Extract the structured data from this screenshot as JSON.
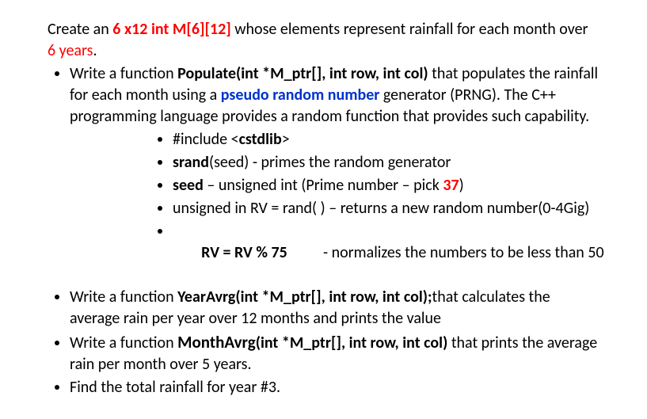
{
  "intro": {
    "p1": "Create an ",
    "p2_bold_red": "6 x12  int  M[6][12]",
    "p3": " whose elements represent rainfall for each month over ",
    "p4_red": "6 years",
    "p5": "."
  },
  "b1": {
    "t1": "Write a function ",
    "t2_bold": "Populate(int *M_ptr[], int row, int col)",
    "t3": " that populates the rainfall for each month using a ",
    "t4_bold_blue": "pseudo random number",
    "t5": " generator (PRNG).  The C++ programming language provides a random function that provides such capability."
  },
  "inner": {
    "i1_a": "#include <",
    "i1_b_bold": "cstdlib",
    "i1_c": ">",
    "i2_a_bold": "srand",
    "i2_b": "(seed)  - primes the random generator",
    "i3_a_bold": "seed",
    "i3_b": " – unsigned int (Prime number – pick ",
    "i3_c_bold_red": "37",
    "i3_d": ")",
    "i4": "unsigned in RV = rand( ) – returns a new random number(0-4Gig)",
    "i5_a_bold": "RV = RV % 75",
    "i5_b": "          - normalizes the numbers to be less than 50"
  },
  "b2": {
    "t1": "Write a function ",
    "t2_bold": "YearAvrg(int *M_ptr[], int row, int col);",
    "t3": "that calculates the average rain  per year over 12 months and prints the value"
  },
  "b3": {
    "t1": "Write a function ",
    "t2_bold": "MonthAvrg",
    "t3_bold": "(int *M_ptr[], int row, int col)",
    "t4": " that prints the average rain per month over 5 years."
  },
  "b4": {
    "t1": "Find the total rainfall for year #3."
  }
}
